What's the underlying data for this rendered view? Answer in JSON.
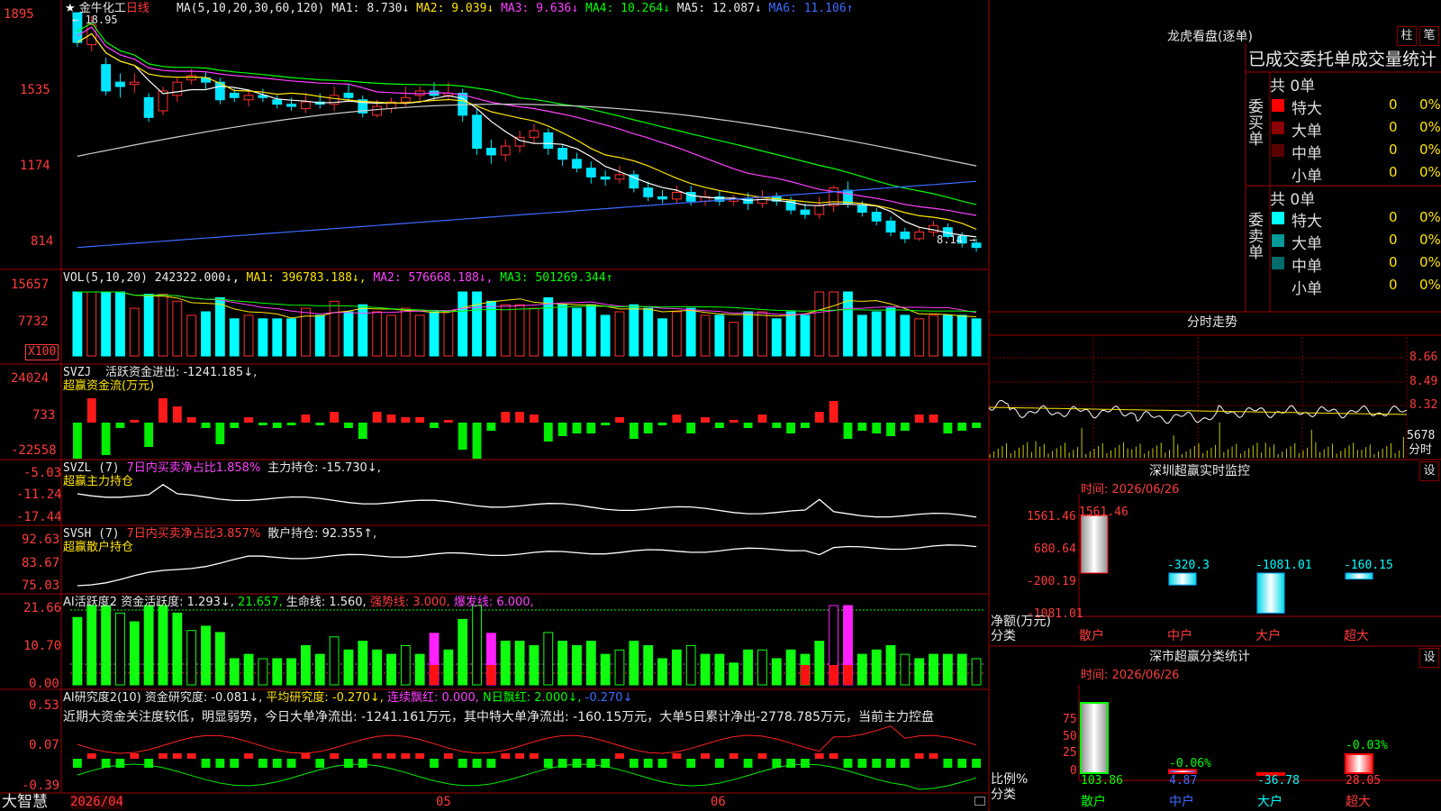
{
  "app": {
    "brand": "大智慧",
    "stock": "金牛化工",
    "period": "日线"
  },
  "main_chart": {
    "ma_label": "MA(5,10,20,30,60,120)",
    "ma_values": [
      {
        "name": "MA1",
        "value": "8.730↓",
        "color": "#ffffff"
      },
      {
        "name": "MA2",
        "value": "9.039↓",
        "color": "#ffe400"
      },
      {
        "name": "MA3",
        "value": "9.636↓",
        "color": "#ff40ff"
      },
      {
        "name": "MA4",
        "value": "10.264↓",
        "color": "#00ff00"
      },
      {
        "name": "MA5",
        "value": "12.087↓",
        "color": "#cccccc"
      },
      {
        "name": "MA6",
        "value": "11.106↑",
        "color": "#3d6bff"
      }
    ],
    "y_ticks": [
      "1895",
      "1535",
      "1174",
      "814"
    ],
    "high_label": "18.95",
    "low_label": "8.14"
  },
  "vol_panel": {
    "label": "VOL(5,10,20)",
    "value": "242322.000↓",
    "ma": [
      {
        "name": "MA1",
        "value": "396783.188↓"
      },
      {
        "name": "MA2",
        "value": "576668.188↓"
      },
      {
        "name": "MA3",
        "value": "501269.344↑"
      }
    ],
    "y_ticks": [
      "15657",
      "7732"
    ],
    "unit": "X100"
  },
  "svzj_panel": {
    "label": "SVZJ",
    "desc": "活跃资金进出: -1241.185↓,",
    "sub": "超赢资金流(万元)",
    "y_ticks": [
      "24024",
      "733",
      "-22558"
    ]
  },
  "svzl_panel": {
    "label": "SVZL (7)",
    "ratio": "7日内买卖净占比1.858%",
    "hold": "主力持仓: -15.730↓,",
    "sub": "超赢主力持仓",
    "y_ticks": [
      "-5.03",
      "-11.24",
      "-17.44"
    ]
  },
  "svsh_panel": {
    "label": "SVSH (7)",
    "ratio": "7日内买卖净占比3.857%",
    "hold": "散户持仓: 92.355↑,",
    "sub": "超赢散户持仓",
    "y_ticks": [
      "92.63",
      "83.67",
      "75.03"
    ]
  },
  "ai_active": {
    "label": "AI活跃度2",
    "a": "资金活跃度: 1.293↓,",
    "b": "21.657,",
    "c": "生命线: 1.560,",
    "d": "强势线: 3.000,",
    "e": "爆发线: 6.000,",
    "y_ticks": [
      "21.66",
      "10.70",
      "0.00"
    ]
  },
  "ai_research": {
    "label": "AI研究度2(10)",
    "a": "资金研究度: -0.081↓,",
    "b": "平均研究度: -0.270↓,",
    "c": "连续飘红: 0.000,",
    "d": "N日飘红: 2.000↓,",
    "e": "-0.270↓",
    "comment": "近期大资金关注度较低，明显弱势，今日大单净流出: -1241.161万元，其中特大单净流出: -160.15万元，大单5日累计净出-2778.785万元，当前主力控盘",
    "y_ticks": [
      "0.53",
      "0.07",
      "-0.39"
    ]
  },
  "x_axis": {
    "labels": [
      "2026/04",
      "05",
      "06"
    ]
  },
  "dragon": {
    "title": "龙虎看盘(逐单)",
    "btn1": "柱",
    "btn2": "笔",
    "subtitle": "已成交委托单成交量统计",
    "buy": {
      "side": "委买单",
      "total": "共 0单",
      "rows": [
        {
          "label": "特大",
          "qty": "0",
          "pct": "0%",
          "color": "#ff0000"
        },
        {
          "label": "大单",
          "qty": "0",
          "pct": "0%",
          "color": "#8b0000"
        },
        {
          "label": "中单",
          "qty": "0",
          "pct": "0%",
          "color": "#5a0000"
        },
        {
          "label": "小单",
          "qty": "0",
          "pct": "0%",
          "color": "#000000"
        }
      ]
    },
    "sell": {
      "side": "委卖单",
      "total": "共 0单",
      "rows": [
        {
          "label": "特大",
          "qty": "0",
          "pct": "0%",
          "color": "#00ffff"
        },
        {
          "label": "大单",
          "qty": "0",
          "pct": "0%",
          "color": "#009a9a"
        },
        {
          "label": "中单",
          "qty": "0",
          "pct": "0%",
          "color": "#006b6b"
        },
        {
          "label": "小单",
          "qty": "0",
          "pct": "0%",
          "color": "#000000"
        }
      ]
    }
  },
  "intraday": {
    "title": "分时走势",
    "y_ticks": [
      "8.66",
      "8.49",
      "8.32"
    ],
    "vol_tick": "5678",
    "vol_label": "分时"
  },
  "monitor": {
    "title": "深圳超赢实时监控",
    "btn": "设",
    "date": "时间: 2026/06/26",
    "y_ticks": [
      "1561.46",
      "680.64",
      "-200.19",
      "-1081.01"
    ],
    "ylabel": "净额(万元)",
    "xlabel": "分类",
    "bars": [
      {
        "cat": "散户",
        "value": 1561.46,
        "label": "1561.46"
      },
      {
        "cat": "中户",
        "value": -320.3,
        "label": "-320.3"
      },
      {
        "cat": "大户",
        "value": -1081.01,
        "label": "-1081.01"
      },
      {
        "cat": "超大",
        "value": -160.15,
        "label": "-160.15"
      }
    ]
  },
  "classify": {
    "title": "深市超赢分类统计",
    "btn": "设",
    "date": "时间: 2026/06/26",
    "y_ticks": [
      "75",
      "50",
      "25",
      "0"
    ],
    "ylabel": "比例%",
    "xlabel": "分类",
    "bars": [
      {
        "cat": "散户",
        "value": 103.86,
        "label": "103.86",
        "top": ""
      },
      {
        "cat": "中户",
        "value": 4.87,
        "label": "4.87",
        "top": "-0.06%"
      },
      {
        "cat": "大户",
        "value": -36.78,
        "label": "-36.78",
        "top": ""
      },
      {
        "cat": "超大",
        "value": 28.05,
        "label": "28.05",
        "top": "-0.03%"
      }
    ]
  },
  "chart_data": {
    "type": "bar",
    "title": "深圳超赢实时监控",
    "categories": [
      "散户",
      "中户",
      "大户",
      "超大"
    ],
    "series": [
      {
        "name": "净额(万元)",
        "values": [
          1561.46,
          -320.3,
          -1081.01,
          -160.15
        ]
      },
      {
        "name": "比例%",
        "values": [
          103.86,
          4.87,
          -36.78,
          28.05
        ]
      }
    ],
    "ylabel": "净额(万元)",
    "candles": [
      [
        18.95,
        17.6,
        18.4,
        17.4
      ],
      [
        17.5,
        18.4,
        18.8,
        17.2
      ],
      [
        16.6,
        15.4,
        16.9,
        15.2
      ],
      [
        15.8,
        15.6,
        16.2,
        15.1
      ],
      [
        15.7,
        15.8,
        16.2,
        15.3
      ],
      [
        15.1,
        14.2,
        15.3,
        14.0
      ],
      [
        14.5,
        15.4,
        15.6,
        14.3
      ],
      [
        15.2,
        15.8,
        16.0,
        14.9
      ],
      [
        15.9,
        16.1,
        16.4,
        15.7
      ],
      [
        16.0,
        15.8,
        16.3,
        15.5
      ],
      [
        15.8,
        15.0,
        16.0,
        14.8
      ],
      [
        15.3,
        15.1,
        15.5,
        14.9
      ],
      [
        15.0,
        15.2,
        15.4,
        14.7
      ],
      [
        15.2,
        15.1,
        15.5,
        14.9
      ],
      [
        15.0,
        14.8,
        15.2,
        14.6
      ],
      [
        14.8,
        14.7,
        15.1,
        14.5
      ],
      [
        14.6,
        14.9,
        15.3,
        14.4
      ],
      [
        14.9,
        14.8,
        15.3,
        14.6
      ],
      [
        14.8,
        15.2,
        15.6,
        14.5
      ],
      [
        15.3,
        15.1,
        15.7,
        14.9
      ],
      [
        15.0,
        14.4,
        15.2,
        14.2
      ],
      [
        14.3,
        14.7,
        15.0,
        14.2
      ],
      [
        14.6,
        14.9,
        15.1,
        14.4
      ],
      [
        14.9,
        15.1,
        15.6,
        14.7
      ],
      [
        15.2,
        15.4,
        15.6,
        14.9
      ],
      [
        15.4,
        15.2,
        15.8,
        15.0
      ],
      [
        15.2,
        15.3,
        15.8,
        15.0
      ],
      [
        15.3,
        14.3,
        15.5,
        14.0
      ],
      [
        14.3,
        12.8,
        14.6,
        12.5
      ],
      [
        12.8,
        12.5,
        13.2,
        12.1
      ],
      [
        12.5,
        12.9,
        13.2,
        12.2
      ],
      [
        12.9,
        13.3,
        13.6,
        12.6
      ],
      [
        13.3,
        13.6,
        13.9,
        13.0
      ],
      [
        13.5,
        12.8,
        13.7,
        12.5
      ],
      [
        12.8,
        12.3,
        13.0,
        12.0
      ],
      [
        12.3,
        11.9,
        12.6,
        11.7
      ],
      [
        11.9,
        11.5,
        12.2,
        11.2
      ],
      [
        11.5,
        11.4,
        11.8,
        11.1
      ],
      [
        11.4,
        11.6,
        12.0,
        11.2
      ],
      [
        11.6,
        11.0,
        11.8,
        10.8
      ],
      [
        11.0,
        10.6,
        11.3,
        10.4
      ],
      [
        10.6,
        10.5,
        10.9,
        10.3
      ],
      [
        10.5,
        10.8,
        11.1,
        10.3
      ],
      [
        10.8,
        10.4,
        11.1,
        10.2
      ],
      [
        10.4,
        10.6,
        10.9,
        10.2
      ],
      [
        10.6,
        10.4,
        10.9,
        10.2
      ],
      [
        10.4,
        10.5,
        10.7,
        10.2
      ],
      [
        10.5,
        10.3,
        10.8,
        10.0
      ],
      [
        10.3,
        10.6,
        10.9,
        10.1
      ],
      [
        10.6,
        10.4,
        10.8,
        10.2
      ],
      [
        10.4,
        10.0,
        10.6,
        9.8
      ],
      [
        10.0,
        9.8,
        10.3,
        9.6
      ],
      [
        9.8,
        10.2,
        10.6,
        9.6
      ],
      [
        10.2,
        11.0,
        11.1,
        9.9
      ],
      [
        10.9,
        10.3,
        11.3,
        10.1
      ],
      [
        10.2,
        9.9,
        10.4,
        9.7
      ],
      [
        9.9,
        9.5,
        10.1,
        9.3
      ],
      [
        9.5,
        9.0,
        9.7,
        8.8
      ],
      [
        9.0,
        8.7,
        9.2,
        8.5
      ],
      [
        8.7,
        9.0,
        9.2,
        8.6
      ],
      [
        9.0,
        9.3,
        9.5,
        8.8
      ],
      [
        9.2,
        8.8,
        9.4,
        8.7
      ],
      [
        8.8,
        8.5,
        9.0,
        8.3
      ],
      [
        8.5,
        8.3,
        8.7,
        8.1
      ]
    ]
  }
}
